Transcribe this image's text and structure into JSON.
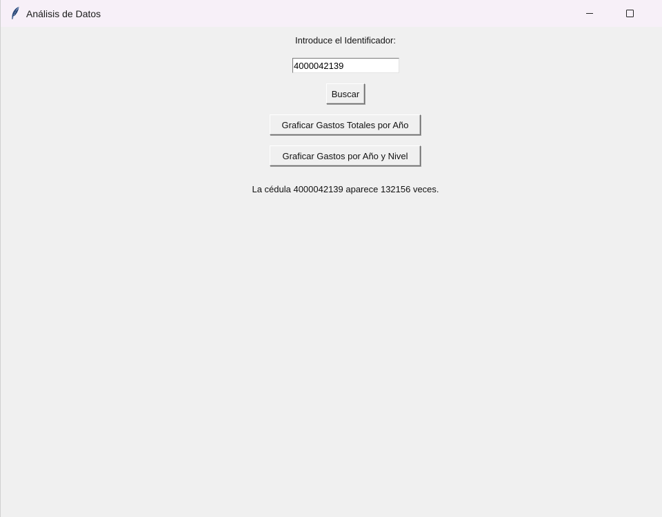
{
  "window": {
    "title": "Análisis de Datos",
    "app_icon": "feather-icon",
    "controls": [
      "minimize-icon",
      "maximize-icon"
    ]
  },
  "form": {
    "identifier_label": "Introduce el Identificador:",
    "identifier_value": "4000042139",
    "search_button": "Buscar",
    "plot_totals_button": "Graficar Gastos Totales por Año",
    "plot_by_level_button": "Graficar Gastos por Año y Nivel"
  },
  "result": {
    "message": "La cédula 4000042139 aparece 132156 veces."
  },
  "colors": {
    "background": "#f0f0f0",
    "titlebar": "#f7f0f8",
    "entry_background": "#ffffff"
  }
}
